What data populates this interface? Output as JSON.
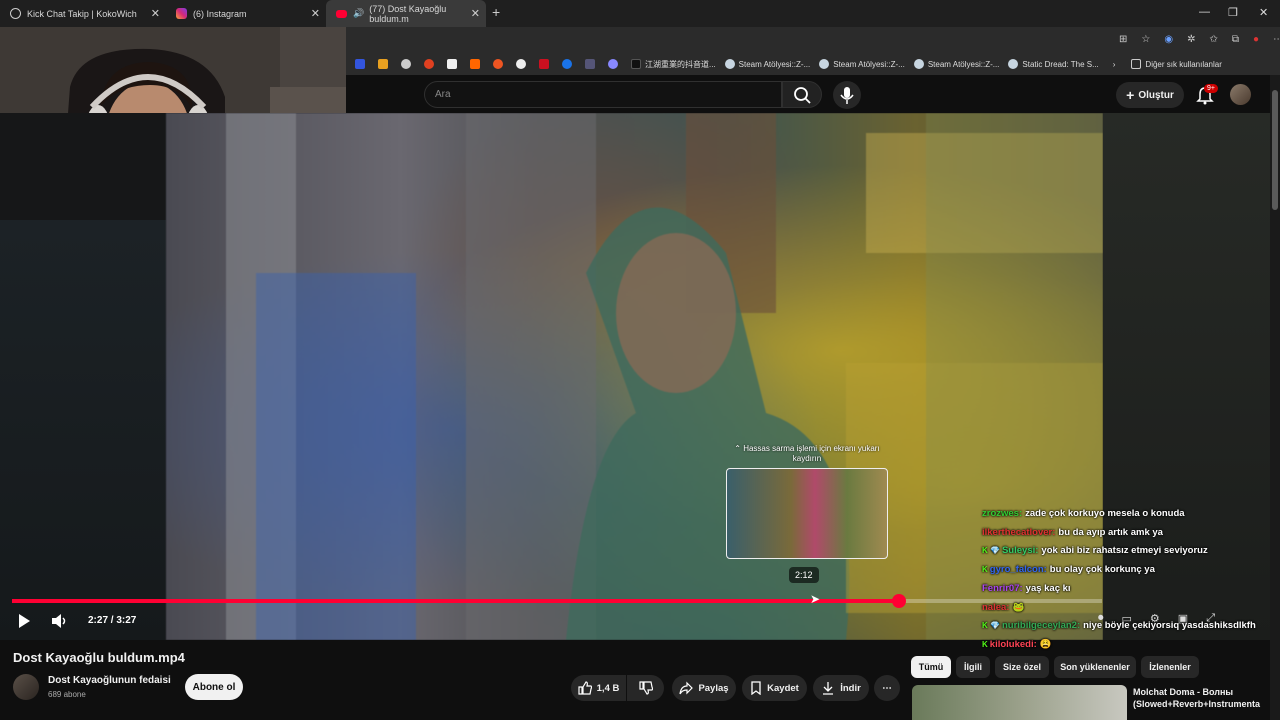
{
  "tabs": [
    {
      "title": "Kick Chat Takip | KokoWich",
      "close": "✕"
    },
    {
      "title": "(6) Instagram",
      "close": "✕"
    },
    {
      "title": "(77) Dost Kayaoğlu buldum.m",
      "close": "✕"
    }
  ],
  "new_tab": "+",
  "window_controls": {
    "minimize": "—",
    "restore": "❐",
    "close": "✕"
  },
  "bookmarks": [
    {
      "label": "",
      "color": "#3355dd"
    },
    {
      "label": "",
      "color": "#e8a020"
    },
    {
      "label": "",
      "color": "#cccccc"
    },
    {
      "label": "",
      "color": "#e04020"
    },
    {
      "label": "",
      "color": "#f0f0f0"
    },
    {
      "label": "",
      "color": "#ff6600"
    },
    {
      "label": "",
      "color": "#ee5522"
    },
    {
      "label": "",
      "color": "#eeeeee"
    },
    {
      "label": "",
      "color": "#cc1020"
    },
    {
      "label": "",
      "color": "#1a73e8"
    },
    {
      "label": "",
      "color": "#555577"
    },
    {
      "label": "",
      "color": "#8888ff"
    },
    {
      "label": "江湖重業的抖音道...",
      "color": "#111111"
    },
    {
      "label": "Steam Atölyesi::Z-...",
      "color": "#1b2838"
    },
    {
      "label": "Steam Atölyesi::Z-...",
      "color": "#1b2838"
    },
    {
      "label": "Steam Atölyesi::Z-...",
      "color": "#1b2838"
    },
    {
      "label": "Static Dread: The S...",
      "color": "#1b2838"
    }
  ],
  "bookmarks_more": "›",
  "other_bookmarks": "Diğer sık kullanılanlar",
  "youtube": {
    "search_placeholder": "Ara",
    "create_label": "Oluştur",
    "notif_count": "9+"
  },
  "video": {
    "hint": "⌃ Hassas sarma işlemi için ekranı yukarı kaydırın",
    "hover_time": "2:12",
    "current_time": "2:27",
    "duration": "3:27",
    "time_display": "2:27 / 3:27",
    "progress": 0.814
  },
  "chat": [
    {
      "user": "zrozwes:",
      "text": "zade çok korkuyo mesela o konuda",
      "color": "#33cc33",
      "badge": ""
    },
    {
      "user": "ilkerthecatlover:",
      "text": "bu da ayıp artık amk ya",
      "color": "#e03030",
      "badge": ""
    },
    {
      "user": "Suleysi:",
      "text": "yok abi biz rahatsız etmeyi seviyoruz",
      "color": "#33cc66",
      "badge": "K 💎"
    },
    {
      "user": "gyro_falcon:",
      "text": "bu olay çok korkunç ya",
      "color": "#3366ee",
      "badge": "K"
    },
    {
      "user": "Fenrir07:",
      "text": "yaş kaç kı",
      "color": "#aa44ee",
      "badge": ""
    },
    {
      "user": "nalea:",
      "text": "🐸",
      "color": "#dd3333",
      "badge": ""
    },
    {
      "user": "nuribilgeceylan2:",
      "text": "niye böyle çekiyorsiq yasdashiksdlkfh",
      "color": "#33aa55",
      "badge": "K 💎"
    },
    {
      "user": "kilolukedi:",
      "text": "😩",
      "color": "#ff4455",
      "badge": "K"
    }
  ],
  "below": {
    "title": "Dost Kayaoğlu buldum.mp4",
    "channel": "Dost Kayaoğlunun fedaisi",
    "subs": "689 abone",
    "subscribe": "Abone ol",
    "likes": "1,4 B",
    "share": "Paylaş",
    "save": "Kaydet",
    "download": "İndir",
    "more": "⋯"
  },
  "chips": [
    "Tümü",
    "İlgili",
    "Size özel",
    "Son yüklenenler",
    "İzlenenler"
  ],
  "recommendation": {
    "title": "Molchat Doma - Волны (Slowed+Reverb+Instrumenta"
  }
}
